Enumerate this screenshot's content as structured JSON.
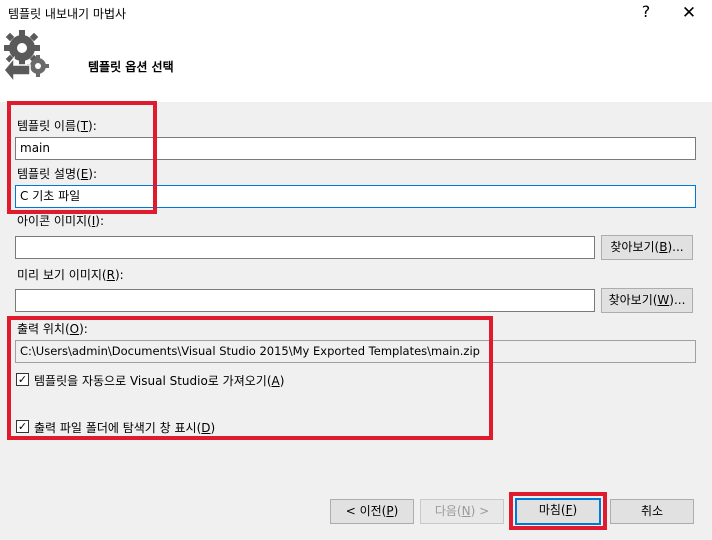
{
  "window": {
    "title": "템플릿 내보내기 마법사",
    "help_glyph": "?",
    "close_glyph": "✕"
  },
  "header": {
    "subtitle": "템플릿 옵션 선택"
  },
  "fields": {
    "template_name": {
      "label": "템플릿 이름(T):",
      "label_pre": "템플릿 이름(",
      "accel": "T",
      "label_post": "):",
      "value": "main"
    },
    "template_desc": {
      "label": "템플릿 설명(E):",
      "label_pre": "템플릿 설명(",
      "accel": "E",
      "label_post": "):",
      "value": "C 기초 파일"
    },
    "icon_image": {
      "label_pre": "아이콘 이미지(",
      "accel": "I",
      "label_post": "):",
      "value": "",
      "browse": "찾아보기(B)...",
      "browse_pre": "찾아보기(",
      "browse_accel": "B",
      "browse_post": ")..."
    },
    "preview_image": {
      "label_pre": "미리 보기 이미지(",
      "accel": "R",
      "label_post": "):",
      "value": "",
      "browse_pre": "찾아보기(",
      "browse_accel": "W",
      "browse_post": ")..."
    },
    "output_location": {
      "label_pre": "출력 위치(",
      "accel": "O",
      "label_post": "):",
      "value": "C:\\Users\\admin\\Documents\\Visual Studio 2015\\My Exported Templates\\main.zip"
    }
  },
  "checkboxes": {
    "auto_import": {
      "label_pre": "템플릿을 자동으로 Visual Studio로 가져오기(",
      "accel": "A",
      "label_post": ")",
      "checked": true,
      "mark": "✓"
    },
    "show_folder": {
      "label_pre": "출력 파일 폴더에 탐색기 창 표시(",
      "accel": "D",
      "label_post": ")",
      "checked": true,
      "mark": "✓"
    }
  },
  "buttons": {
    "prev": {
      "pre": "< 이전(",
      "accel": "P",
      "post": ")"
    },
    "next": {
      "pre": "다음(",
      "accel": "N",
      "post": ") >"
    },
    "finish": {
      "pre": "마침(",
      "accel": "F",
      "post": ")"
    },
    "cancel": {
      "label": "취소"
    }
  },
  "colors": {
    "highlight": "#e01b2e",
    "focus": "#0078d7"
  }
}
